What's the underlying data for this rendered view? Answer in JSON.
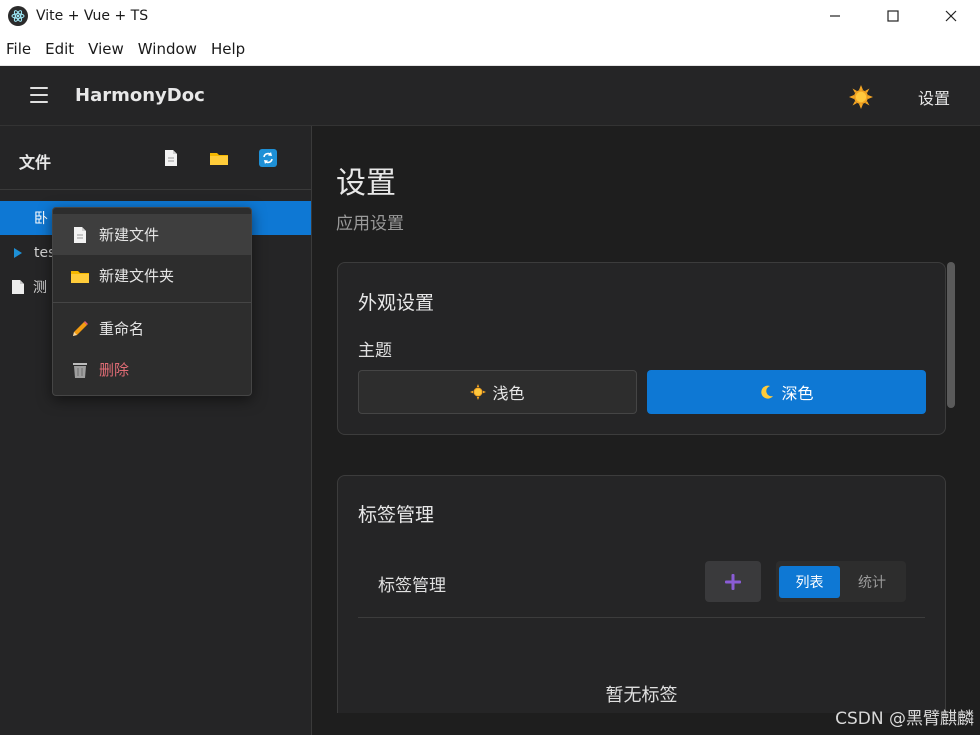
{
  "window": {
    "title": "Vite + Vue + TS"
  },
  "menu": [
    "File",
    "Edit",
    "View",
    "Window",
    "Help"
  ],
  "header": {
    "app_name": "HarmonyDoc",
    "settings_label": "设置"
  },
  "sidebar": {
    "title": "文件",
    "tree": [
      {
        "label": "卧",
        "type": "file",
        "selected": true
      },
      {
        "label": "tes",
        "type": "folder",
        "selected": false
      },
      {
        "label": "测",
        "type": "file",
        "selected": false
      }
    ]
  },
  "context_menu": {
    "new_file": "新建文件",
    "new_folder": "新建文件夹",
    "rename": "重命名",
    "delete": "删除"
  },
  "main": {
    "title": "设置",
    "subtitle": "应用设置",
    "appearance": {
      "title": "外观设置",
      "theme_label": "主题",
      "light": "浅色",
      "dark": "深色"
    },
    "tags": {
      "title": "标签管理",
      "row_label": "标签管理",
      "view_list": "列表",
      "view_stats": "统计",
      "empty": "暂无标签"
    }
  },
  "watermark": "CSDN @黑臂麒麟",
  "colors": {
    "accent": "#0e78d4",
    "danger": "#e06c75",
    "background": "#1e1e1e",
    "panel": "#252526"
  }
}
